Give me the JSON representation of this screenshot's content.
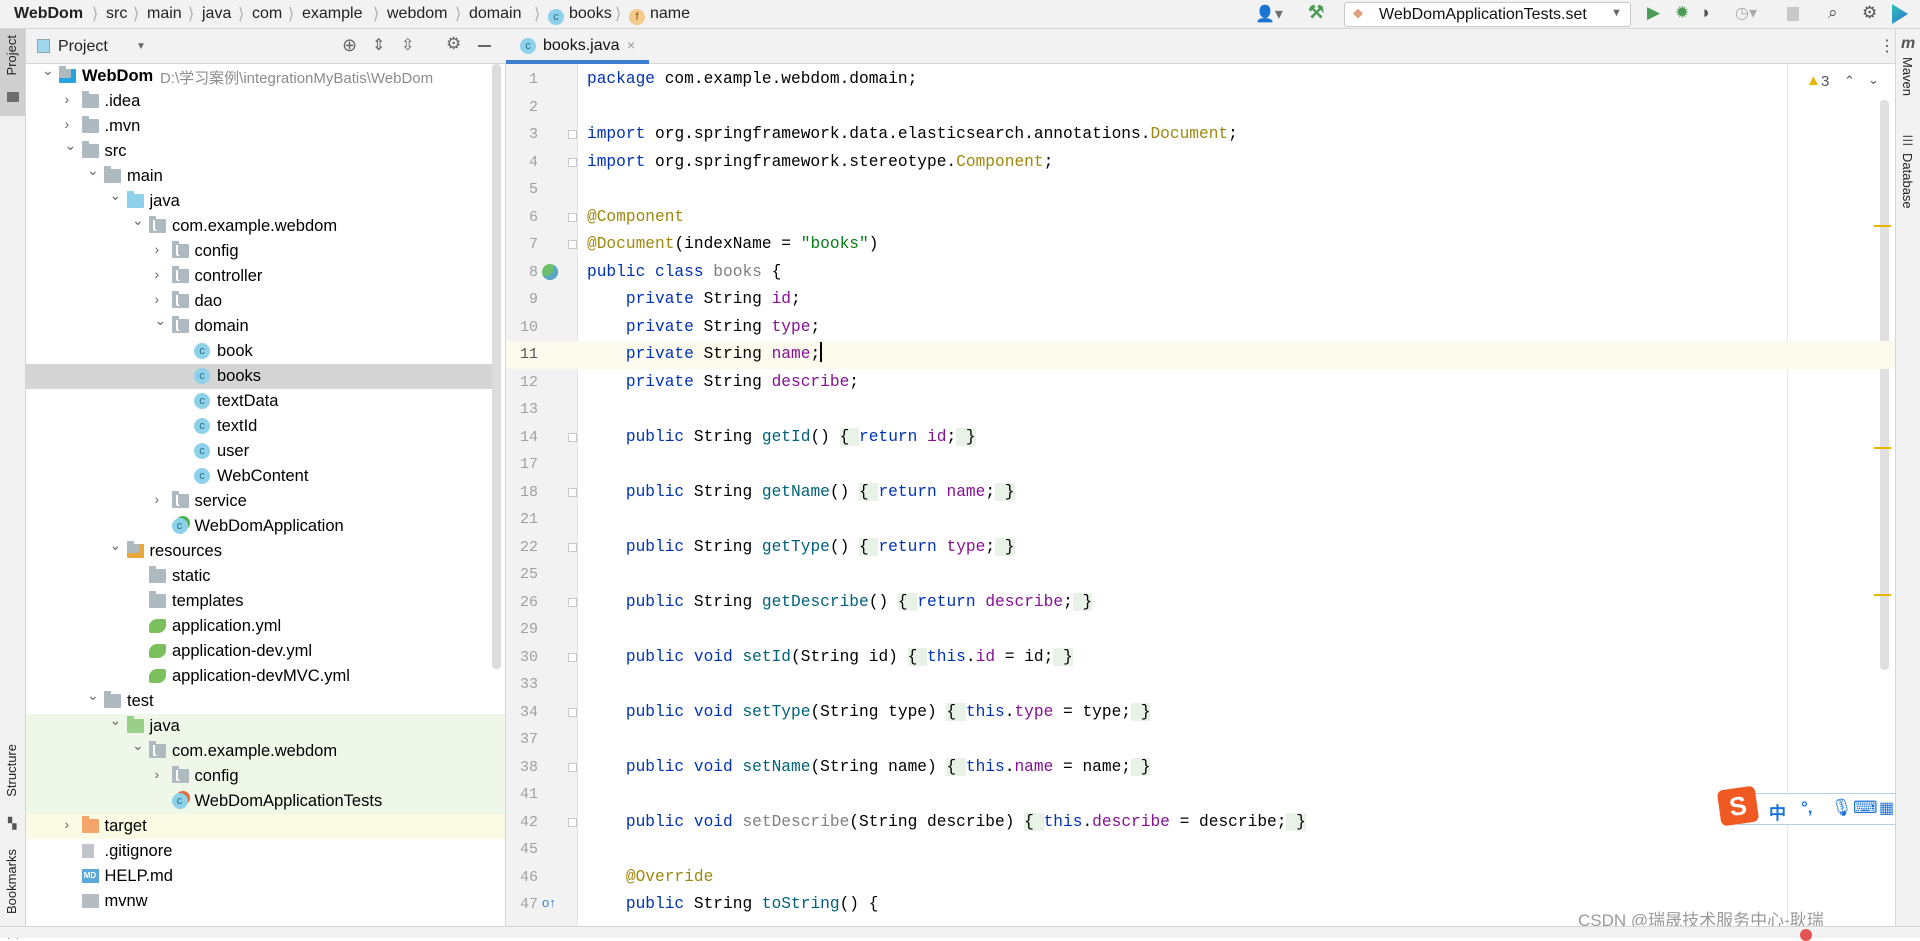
{
  "breadcrumb": [
    "WebDom",
    "src",
    "main",
    "java",
    "com",
    "example",
    "webdom",
    "domain",
    "books",
    "name"
  ],
  "toolbar": {
    "run_config": "WebDomApplicationTests.set",
    "icons": [
      "user-icon",
      "hammer-icon",
      "run-icon",
      "debug-icon",
      "coverage-icon",
      "profiler-icon",
      "stop-icon",
      "search-icon",
      "gear-icon",
      "toolbox-icon"
    ]
  },
  "left_strip": {
    "project": "Project",
    "structure": "Structure",
    "bookmarks": "Bookmarks"
  },
  "right_strip": {
    "maven": "Maven",
    "database": "Database"
  },
  "project_panel": {
    "title": "Project",
    "tree": [
      {
        "level": 0,
        "state": "open",
        "icon": "module",
        "label": "WebDom",
        "path": "D:\\学习案例\\integrationMyBatis\\WebDom"
      },
      {
        "level": 1,
        "state": "closed",
        "icon": "folder",
        "label": ".idea"
      },
      {
        "level": 1,
        "state": "closed",
        "icon": "folder",
        "label": ".mvn"
      },
      {
        "level": 1,
        "state": "open",
        "icon": "folder",
        "label": "src"
      },
      {
        "level": 2,
        "state": "open",
        "icon": "folder",
        "label": "main"
      },
      {
        "level": 3,
        "state": "open",
        "icon": "folder-src",
        "label": "java"
      },
      {
        "level": 4,
        "state": "open",
        "icon": "package",
        "label": "com.example.webdom"
      },
      {
        "level": 5,
        "state": "closed",
        "icon": "package",
        "label": "config"
      },
      {
        "level": 5,
        "state": "closed",
        "icon": "package",
        "label": "controller"
      },
      {
        "level": 5,
        "state": "closed",
        "icon": "package",
        "label": "dao"
      },
      {
        "level": 5,
        "state": "open",
        "icon": "package",
        "label": "domain"
      },
      {
        "level": 6,
        "state": "leaf",
        "icon": "class",
        "label": "book"
      },
      {
        "level": 6,
        "state": "leaf",
        "icon": "class",
        "label": "books",
        "selected": true
      },
      {
        "level": 6,
        "state": "leaf",
        "icon": "class",
        "label": "textData"
      },
      {
        "level": 6,
        "state": "leaf",
        "icon": "class",
        "label": "textId"
      },
      {
        "level": 6,
        "state": "leaf",
        "icon": "class",
        "label": "user"
      },
      {
        "level": 6,
        "state": "leaf",
        "icon": "class",
        "label": "WebContent"
      },
      {
        "level": 5,
        "state": "closed",
        "icon": "package",
        "label": "service"
      },
      {
        "level": 5,
        "state": "leaf",
        "icon": "spring-class",
        "label": "WebDomApplication"
      },
      {
        "level": 3,
        "state": "open",
        "icon": "folder-res",
        "label": "resources"
      },
      {
        "level": 4,
        "state": "leaf",
        "icon": "folder",
        "label": "static"
      },
      {
        "level": 4,
        "state": "leaf",
        "icon": "folder",
        "label": "templates"
      },
      {
        "level": 4,
        "state": "leaf",
        "icon": "yml",
        "label": "application.yml"
      },
      {
        "level": 4,
        "state": "leaf",
        "icon": "yml",
        "label": "application-dev.yml"
      },
      {
        "level": 4,
        "state": "leaf",
        "icon": "yml",
        "label": "application-devMVC.yml"
      },
      {
        "level": 2,
        "state": "open",
        "icon": "folder",
        "label": "test"
      },
      {
        "level": 3,
        "state": "open",
        "icon": "folder-test",
        "label": "java",
        "bg": "test"
      },
      {
        "level": 4,
        "state": "open",
        "icon": "package",
        "label": "com.example.webdom",
        "bg": "test"
      },
      {
        "level": 5,
        "state": "closed",
        "icon": "package",
        "label": "config",
        "bg": "test"
      },
      {
        "level": 5,
        "state": "leaf",
        "icon": "test-class",
        "label": "WebDomApplicationTests",
        "bg": "test"
      },
      {
        "level": 1,
        "state": "closed",
        "icon": "folder-excluded",
        "label": "target",
        "bg": "excluded"
      },
      {
        "level": 1,
        "state": "leaf",
        "icon": "gitignore",
        "label": ".gitignore"
      },
      {
        "level": 1,
        "state": "leaf",
        "icon": "md",
        "label": "HELP.md"
      },
      {
        "level": 1,
        "state": "leaf",
        "icon": "script",
        "label": "mvnw"
      }
    ]
  },
  "editor": {
    "tab": "books.java",
    "warnings": "3",
    "caret_line": "11",
    "lines": [
      {
        "n": "1",
        "t": [
          [
            "package",
            "kw"
          ],
          [
            " com.example.webdom.domain;",
            ""
          ]
        ]
      },
      {
        "n": "2",
        "t": []
      },
      {
        "n": "3",
        "t": [
          [
            "import",
            "kw"
          ],
          [
            " org.springframework.data.elasticsearch.annotations.",
            ""
          ],
          [
            "Document",
            "ann"
          ],
          [
            ";",
            ""
          ]
        ]
      },
      {
        "n": "4",
        "t": [
          [
            "import",
            "kw"
          ],
          [
            " org.springframework.stereotype.",
            ""
          ],
          [
            "Component",
            "ann"
          ],
          [
            ";",
            ""
          ]
        ]
      },
      {
        "n": "5",
        "t": []
      },
      {
        "n": "6",
        "t": [
          [
            "@Component",
            "ann"
          ]
        ]
      },
      {
        "n": "7",
        "t": [
          [
            "@Document",
            "ann"
          ],
          [
            "(indexName = ",
            ""
          ],
          [
            "\"books\"",
            "str"
          ],
          [
            ")",
            ""
          ]
        ]
      },
      {
        "n": "8",
        "t": [
          [
            "public class",
            "kw"
          ],
          [
            " ",
            ""
          ],
          [
            "books",
            "gray"
          ],
          [
            " {",
            ""
          ]
        ]
      },
      {
        "n": "9",
        "t": [
          [
            "    ",
            ""
          ],
          [
            "private",
            "kw"
          ],
          [
            " String ",
            ""
          ],
          [
            "id",
            "field"
          ],
          [
            ";",
            ""
          ]
        ]
      },
      {
        "n": "10",
        "t": [
          [
            "    ",
            ""
          ],
          [
            "private",
            "kw"
          ],
          [
            " String ",
            ""
          ],
          [
            "type",
            "field"
          ],
          [
            ";",
            ""
          ]
        ]
      },
      {
        "n": "11",
        "t": [
          [
            "    ",
            ""
          ],
          [
            "private",
            "kw"
          ],
          [
            " String ",
            ""
          ],
          [
            "name",
            "field"
          ],
          [
            ";",
            ""
          ]
        ]
      },
      {
        "n": "12",
        "t": [
          [
            "    ",
            ""
          ],
          [
            "private",
            "kw"
          ],
          [
            " String ",
            ""
          ],
          [
            "describe",
            "field"
          ],
          [
            ";",
            ""
          ]
        ]
      },
      {
        "n": "13",
        "t": []
      },
      {
        "n": "14",
        "t": [
          [
            "    ",
            ""
          ],
          [
            "public",
            "kw"
          ],
          [
            " String ",
            ""
          ],
          [
            "getId",
            "method"
          ],
          [
            "() ",
            ""
          ],
          [
            "{ ",
            "fold"
          ],
          [
            "return",
            "kw"
          ],
          [
            " ",
            ""
          ],
          [
            "id",
            "field"
          ],
          [
            ";",
            ""
          ],
          [
            " }",
            "fold"
          ]
        ]
      },
      {
        "n": "17",
        "t": []
      },
      {
        "n": "18",
        "t": [
          [
            "    ",
            ""
          ],
          [
            "public",
            "kw"
          ],
          [
            " String ",
            ""
          ],
          [
            "getName",
            "method"
          ],
          [
            "() ",
            ""
          ],
          [
            "{ ",
            "fold"
          ],
          [
            "return",
            "kw"
          ],
          [
            " ",
            ""
          ],
          [
            "name",
            "field"
          ],
          [
            ";",
            ""
          ],
          [
            " }",
            "fold"
          ]
        ]
      },
      {
        "n": "21",
        "t": []
      },
      {
        "n": "22",
        "t": [
          [
            "    ",
            ""
          ],
          [
            "public",
            "kw"
          ],
          [
            " String ",
            ""
          ],
          [
            "getType",
            "method"
          ],
          [
            "() ",
            ""
          ],
          [
            "{ ",
            "fold"
          ],
          [
            "return",
            "kw"
          ],
          [
            " ",
            ""
          ],
          [
            "type",
            "field"
          ],
          [
            ";",
            ""
          ],
          [
            " }",
            "fold"
          ]
        ]
      },
      {
        "n": "25",
        "t": []
      },
      {
        "n": "26",
        "t": [
          [
            "    ",
            ""
          ],
          [
            "public",
            "kw"
          ],
          [
            " String ",
            ""
          ],
          [
            "getDescribe",
            "method"
          ],
          [
            "() ",
            ""
          ],
          [
            "{ ",
            "fold"
          ],
          [
            "return",
            "kw"
          ],
          [
            " ",
            ""
          ],
          [
            "describe",
            "field"
          ],
          [
            ";",
            ""
          ],
          [
            " }",
            "fold"
          ]
        ]
      },
      {
        "n": "29",
        "t": []
      },
      {
        "n": "30",
        "t": [
          [
            "    ",
            ""
          ],
          [
            "public void",
            "kw"
          ],
          [
            " ",
            ""
          ],
          [
            "setId",
            "method"
          ],
          [
            "(String id) ",
            ""
          ],
          [
            "{ ",
            "fold"
          ],
          [
            "this",
            "kw"
          ],
          [
            ".",
            ""
          ],
          [
            "id",
            "field"
          ],
          [
            " = id;",
            ""
          ],
          [
            " }",
            "fold"
          ]
        ]
      },
      {
        "n": "33",
        "t": []
      },
      {
        "n": "34",
        "t": [
          [
            "    ",
            ""
          ],
          [
            "public void",
            "kw"
          ],
          [
            " ",
            ""
          ],
          [
            "setType",
            "method"
          ],
          [
            "(String type) ",
            ""
          ],
          [
            "{ ",
            "fold"
          ],
          [
            "this",
            "kw"
          ],
          [
            ".",
            ""
          ],
          [
            "type",
            "field"
          ],
          [
            " = type;",
            ""
          ],
          [
            " }",
            "fold"
          ]
        ]
      },
      {
        "n": "37",
        "t": []
      },
      {
        "n": "38",
        "t": [
          [
            "    ",
            ""
          ],
          [
            "public void",
            "kw"
          ],
          [
            " ",
            ""
          ],
          [
            "setName",
            "method"
          ],
          [
            "(String name) ",
            ""
          ],
          [
            "{ ",
            "fold"
          ],
          [
            "this",
            "kw"
          ],
          [
            ".",
            ""
          ],
          [
            "name",
            "field"
          ],
          [
            " = name;",
            ""
          ],
          [
            " }",
            "fold"
          ]
        ]
      },
      {
        "n": "41",
        "t": []
      },
      {
        "n": "42",
        "t": [
          [
            "    ",
            ""
          ],
          [
            "public void",
            "kw"
          ],
          [
            " ",
            ""
          ],
          [
            "setDescribe",
            "gray"
          ],
          [
            "(String describe) ",
            ""
          ],
          [
            "{ ",
            "fold"
          ],
          [
            "this",
            "kw"
          ],
          [
            ".",
            ""
          ],
          [
            "describe",
            "field"
          ],
          [
            " = describe;",
            ""
          ],
          [
            " }",
            "fold"
          ]
        ]
      },
      {
        "n": "45",
        "t": []
      },
      {
        "n": "46",
        "t": [
          [
            "    ",
            ""
          ],
          [
            "@Override",
            "ann"
          ]
        ]
      },
      {
        "n": "47",
        "t": [
          [
            "    ",
            ""
          ],
          [
            "public",
            "kw"
          ],
          [
            " String ",
            ""
          ],
          [
            "toString",
            "method"
          ],
          [
            "() {",
            ""
          ]
        ]
      }
    ]
  },
  "ime": {
    "mode": "中",
    "punct": "°,"
  },
  "watermark": "CSDN @瑞晟技术服务中心-耿瑞",
  "colors": {
    "accent": "#3d7fd1",
    "selection": "#d5d5d5",
    "test_bg": "#eff8e8",
    "excluded_bg": "#fbfbe5",
    "caret_line": "#fcfaed",
    "fold_bg": "#e8f2e6"
  }
}
